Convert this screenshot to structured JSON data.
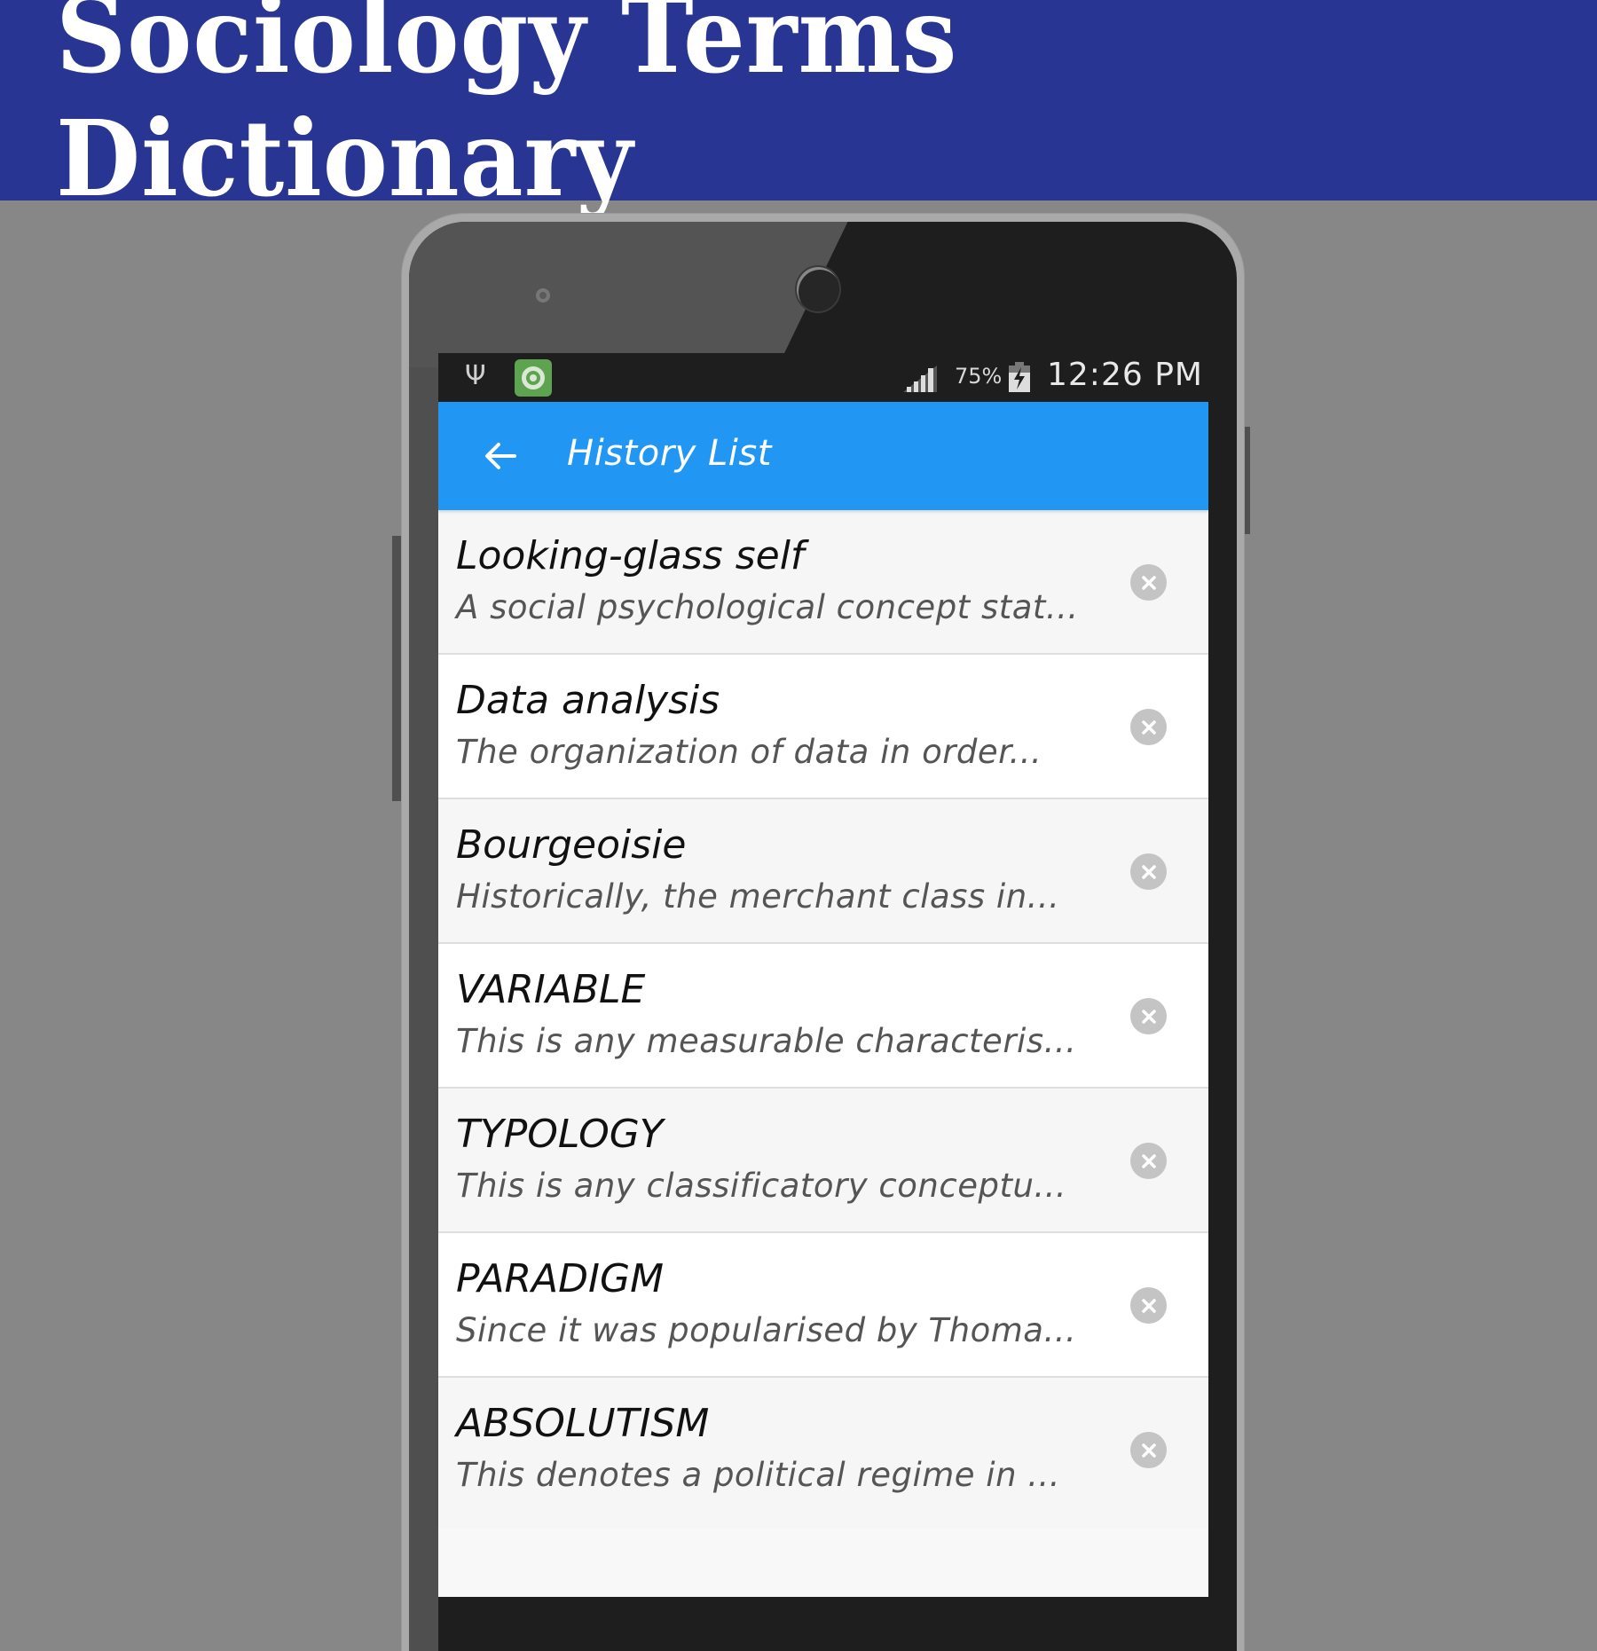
{
  "banner": {
    "title": "Sociology Terms Dictionary",
    "background": "#283593"
  },
  "status_bar": {
    "icons": [
      "usb-icon",
      "app-notification-icon",
      "signal-icon",
      "battery-charging-icon"
    ],
    "battery_percent": "75%",
    "time": "12:26 PM"
  },
  "app_bar": {
    "back_icon": "arrow-back-icon",
    "title": "History List",
    "color": "#2196f3"
  },
  "history": [
    {
      "term": "Looking-glass self",
      "snippet": "A social psychological concept stat..."
    },
    {
      "term": "Data analysis",
      "snippet": "The organization of data in order..."
    },
    {
      "term": "Bourgeoisie",
      "snippet": "Historically, the merchant class in..."
    },
    {
      "term": "VARIABLE",
      "snippet": "This is any measurable characteris..."
    },
    {
      "term": "TYPOLOGY",
      "snippet": "This is any classificatory conceptu..."
    },
    {
      "term": "PARADIGM",
      "snippet": "Since it was popularised by Thoma..."
    },
    {
      "term": "ABSOLUTISM",
      "snippet": "This denotes a political regime in ..."
    }
  ],
  "row_action_icon": "remove-circle-icon"
}
